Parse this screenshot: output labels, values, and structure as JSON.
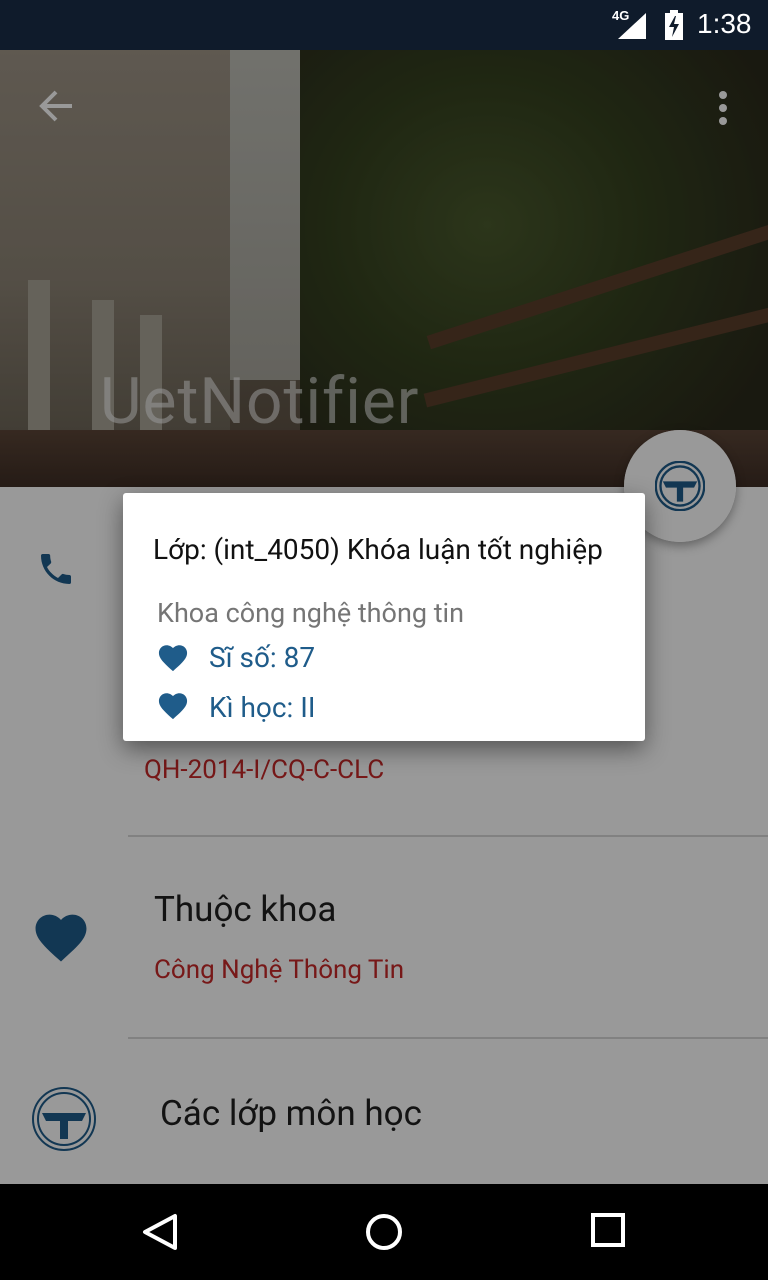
{
  "status_bar": {
    "network": "4G",
    "time": "1:38"
  },
  "header": {
    "app_title": "UetNotifier"
  },
  "rows": [
    {
      "icon": "phone-icon",
      "label": "",
      "value": "QH-2014-I/CQ-C-CLC"
    },
    {
      "icon": "heart-icon",
      "label": "Thuộc khoa",
      "value": "Công Nghệ Thông Tin"
    },
    {
      "icon": "university-logo-icon",
      "label": "Các lớp môn học",
      "value": ""
    }
  ],
  "dialog": {
    "title": "Lớp: (int_4050) Khóa luận tốt nghiệp",
    "department": "Khoa công nghệ thông tin",
    "lines": [
      {
        "icon": "heart-icon",
        "text": "Sĩ số:  87"
      },
      {
        "icon": "heart-icon",
        "text": "Kì học: II"
      }
    ]
  },
  "nav_bar": {
    "buttons": [
      "back-icon",
      "home-icon",
      "recents-icon"
    ]
  },
  "colors": {
    "accent_blue": "#1f5c8a",
    "value_red": "#c62828",
    "status_bar": "#0f1b2b"
  }
}
